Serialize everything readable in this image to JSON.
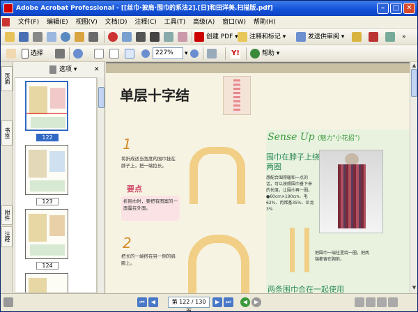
{
  "window": {
    "title": "Adobe Acrobat Professional - [[丝巾·披肩·围巾的系法2].[日]和田洋美.扫描版.pdf]"
  },
  "menu": [
    "文件(F)",
    "编辑(E)",
    "视图(V)",
    "文档(D)",
    "注释(C)",
    "工具(T)",
    "高级(A)",
    "窗口(W)",
    "帮助(H)"
  ],
  "toolbar1": {
    "create_pdf": "创建 PDF",
    "comment_markup": "注释和标记",
    "send_review": "发送供审阅"
  },
  "toolbar2": {
    "select": "选择",
    "zoom_value": "227%",
    "help": "帮助"
  },
  "panel": {
    "options": "选项",
    "tabs": [
      "页面",
      "书签",
      "注释",
      "附件"
    ],
    "thumbs": [
      {
        "label": "122",
        "selected": true
      },
      {
        "label": "123",
        "selected": false
      },
      {
        "label": "124",
        "selected": false
      }
    ]
  },
  "page_content": {
    "title": "单层十字结",
    "sense_up": "Sense Up",
    "sense_up_note": "(魅力\"小花招\")",
    "green_title": "围巾在脖子上绕两圈",
    "green_text": "想配合围得暖和一点的话，可以按照围巾垂下来的长度，让围巾再一圈。",
    "green_size": "●60cm×190cm、毛62%、丙烯基35%、尼龙3%",
    "green_title2": "两条围巾合在一起使用",
    "green_text2": "把围巾一端往里绕一圈，把两端都留在胸前。",
    "step1_num": "1",
    "step1_text": "将折成适当宽度的围巾挂在脖子上，把一端拉长。",
    "keypoint": "要点",
    "keypoint_text": "折围巾时，要把有图案的一面露在外面。",
    "step2_num": "2",
    "step2_text": "把长的一端搭在另一侧的肩膀上。"
  },
  "status": {
    "page_field": "第 122 / 130 页"
  }
}
